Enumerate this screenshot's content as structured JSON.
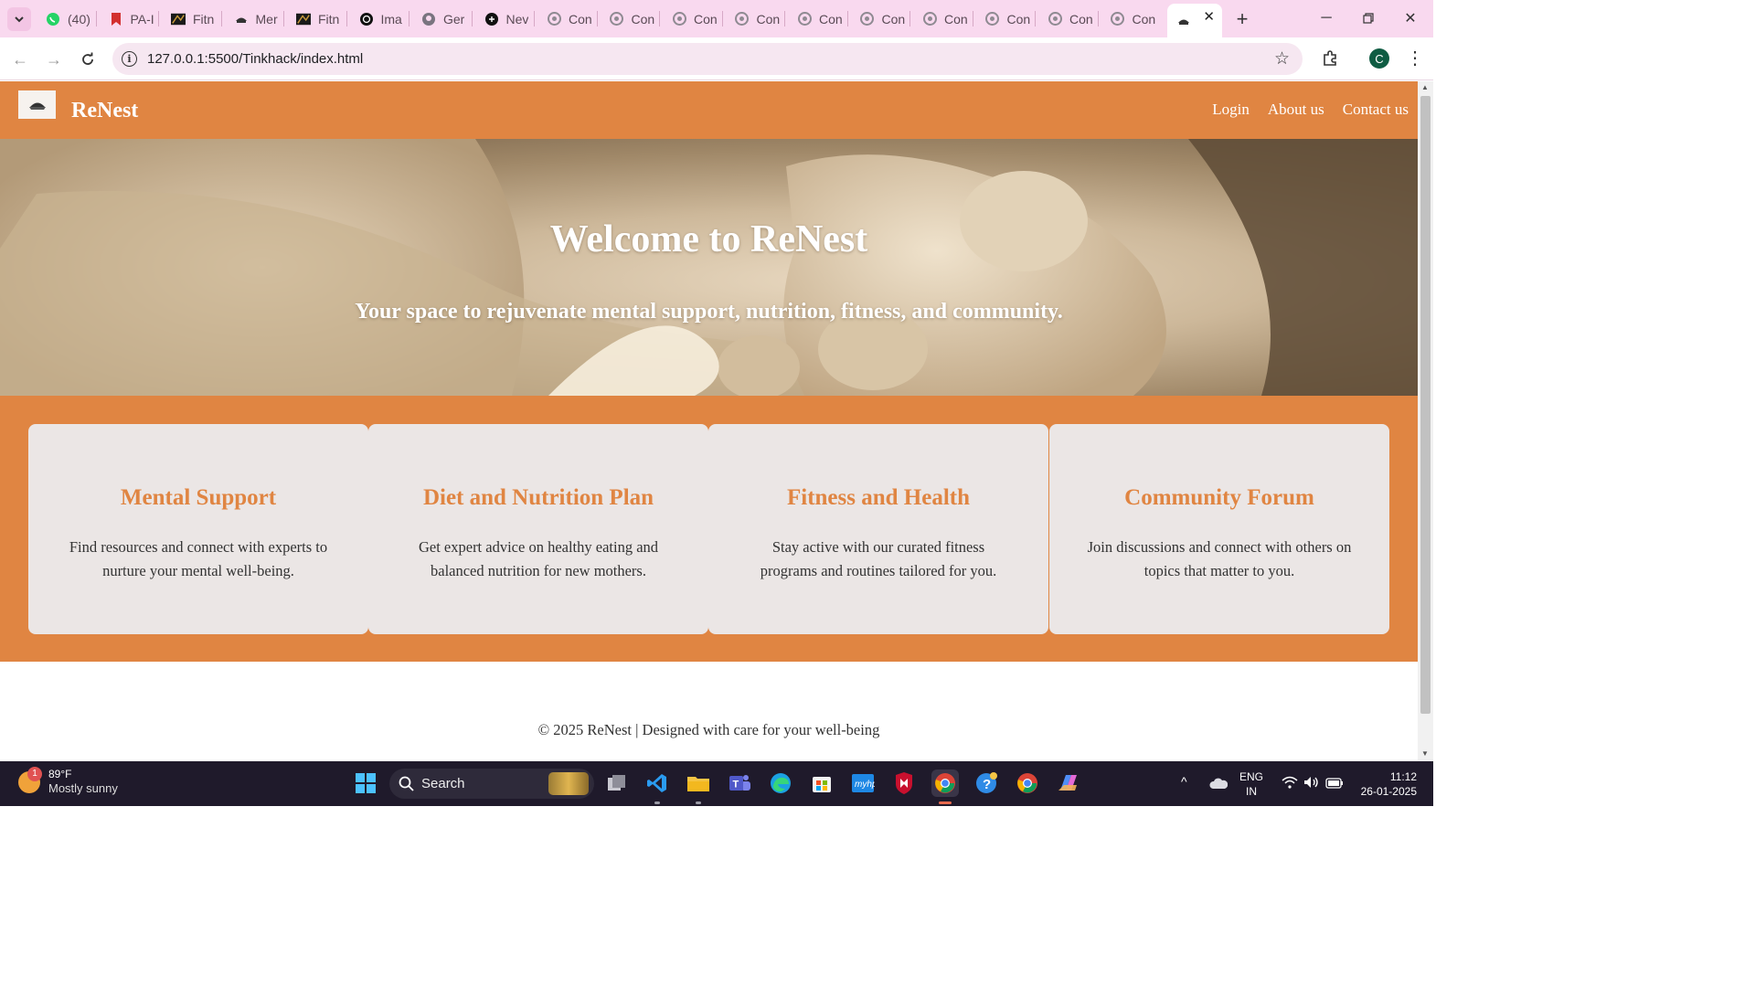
{
  "browser": {
    "tabs": [
      {
        "title": "(40)",
        "icon": "whatsapp-icon",
        "color": "#25d366"
      },
      {
        "title": "PA-I",
        "icon": "pa-icon",
        "color": "#d32f2f"
      },
      {
        "title": "Fitn",
        "icon": "fitness-icon",
        "color": "#333333"
      },
      {
        "title": "Mer",
        "icon": "renest-icon",
        "color": "#333333"
      },
      {
        "title": "Fitn",
        "icon": "fitness-icon",
        "color": "#333333"
      },
      {
        "title": "Ima",
        "icon": "openai-icon",
        "color": "#111111"
      },
      {
        "title": "Ger",
        "icon": "github-icon",
        "color": "#7a7480"
      },
      {
        "title": "Nev",
        "icon": "chatgpt-icon",
        "color": "#111111"
      },
      {
        "title": "Con",
        "icon": "globe-icon",
        "color": "#8f8a92"
      },
      {
        "title": "Con",
        "icon": "globe-icon",
        "color": "#8f8a92"
      },
      {
        "title": "Con",
        "icon": "globe-icon",
        "color": "#8f8a92"
      },
      {
        "title": "Con",
        "icon": "globe-icon",
        "color": "#8f8a92"
      },
      {
        "title": "Con",
        "icon": "globe-icon",
        "color": "#8f8a92"
      },
      {
        "title": "Con",
        "icon": "globe-icon",
        "color": "#8f8a92"
      },
      {
        "title": "Con",
        "icon": "globe-icon",
        "color": "#8f8a92"
      },
      {
        "title": "Con",
        "icon": "globe-icon",
        "color": "#8f8a92"
      },
      {
        "title": "Con",
        "icon": "globe-icon",
        "color": "#8f8a92"
      },
      {
        "title": "Con",
        "icon": "globe-icon",
        "color": "#8f8a92"
      }
    ],
    "active_tab": {
      "title": "",
      "icon": "renest-icon"
    },
    "url": "127.0.0.1:5500/Tinkhack/index.html",
    "profile_initial": "C",
    "accent": "#f9d9ef"
  },
  "site": {
    "brand": "ReNest",
    "nav": [
      "Login",
      "About us",
      "Contact us"
    ],
    "hero": {
      "title": "Welcome to ReNest",
      "subtitle": "Your space to rejuvenate mental support, nutrition, fitness, and community."
    },
    "features": [
      {
        "title": "Mental Support",
        "text": "Find resources and connect with experts to nurture your mental well-being."
      },
      {
        "title": "Diet and Nutrition Plan",
        "text": "Get expert advice on healthy eating and balanced nutrition for new mothers."
      },
      {
        "title": "Fitness and Health",
        "text": "Stay active with our curated fitness programs and routines tailored for you."
      },
      {
        "title": "Community Forum",
        "text": "Join discussions and connect with others on topics that matter to you."
      }
    ],
    "footer": "© 2025 ReNest | Designed with care for your well-being",
    "colors": {
      "primary": "#e08542",
      "card": "#ebe6e5",
      "text": "#333333"
    }
  },
  "taskbar": {
    "weather": {
      "temp": "89°F",
      "condition": "Mostly sunny",
      "badge": "1"
    },
    "search_label": "Search",
    "apps": [
      "windows-start-icon",
      "task-view-icon",
      "vscode-icon",
      "file-explorer-icon",
      "teams-icon",
      "edge-icon",
      "store-icon",
      "myhp-icon",
      "mcafee-icon",
      "chrome-icon",
      "help-icon",
      "chrome-alt-icon",
      "copilot-icon"
    ],
    "language": {
      "line1": "ENG",
      "line2": "IN"
    },
    "time": "11:12",
    "date": "26-01-2025"
  }
}
